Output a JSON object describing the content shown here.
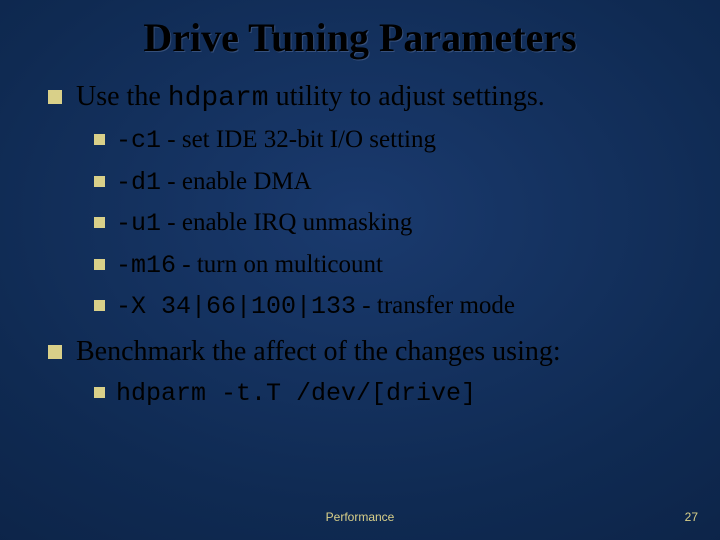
{
  "title": "Drive Tuning Parameters",
  "items": [
    {
      "pre": "Use the ",
      "code": "hdparm",
      "post": " utility to adjust settings.",
      "sub": [
        {
          "code": "-c1",
          "desc": "set IDE 32-bit I/O setting"
        },
        {
          "code": "-d1",
          "desc": "enable DMA"
        },
        {
          "code": "-u1",
          "desc": "enable IRQ unmasking"
        },
        {
          "code": "-m16",
          "desc": "turn on multicount"
        },
        {
          "code": "-X 34|66|100|133",
          "desc": "transfer mode"
        }
      ]
    },
    {
      "pre": "Benchmark the affect of the changes using:",
      "code": "",
      "post": "",
      "sub": [
        {
          "code": "hdparm -t.T /dev/[drive]",
          "desc": ""
        }
      ]
    }
  ],
  "footer": {
    "label": "Performance",
    "page": "27"
  }
}
